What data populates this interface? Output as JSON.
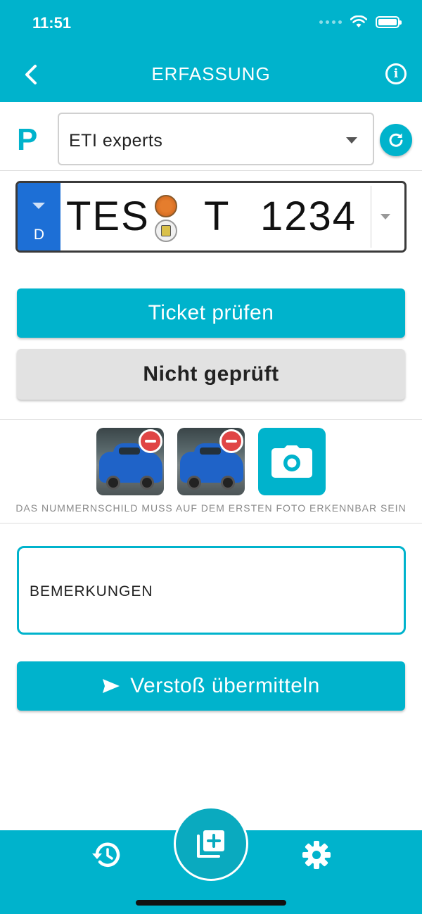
{
  "status_bar": {
    "time": "11:51"
  },
  "header": {
    "title": "ERFASSUNG"
  },
  "operator": {
    "parking_symbol": "P",
    "selected": "ETI experts"
  },
  "plate": {
    "country_code": "D",
    "district": "TES",
    "letters": "T",
    "number": "1234"
  },
  "buttons": {
    "check_ticket": "Ticket prüfen",
    "not_checked": "Nicht geprüft",
    "submit": "Verstoß übermitteln"
  },
  "photos": {
    "count": 2,
    "hint": "DAS NUMMERNSCHILD MUSS AUF DEM ERSTEN FOTO ERKENNBAR SEIN"
  },
  "remarks": {
    "placeholder": "BEMERKUNGEN"
  },
  "colors": {
    "accent": "#00b3cc",
    "plate_blue": "#1d6fd6",
    "remove_red": "#e04545",
    "button_gray": "#e2e2e2"
  },
  "icons": {
    "back": "chevron-left-icon",
    "info": "info-icon",
    "refresh": "refresh-icon",
    "camera": "camera-icon",
    "send": "send-icon",
    "history": "history-icon",
    "add": "add-photo-icon",
    "settings": "gear-icon"
  }
}
